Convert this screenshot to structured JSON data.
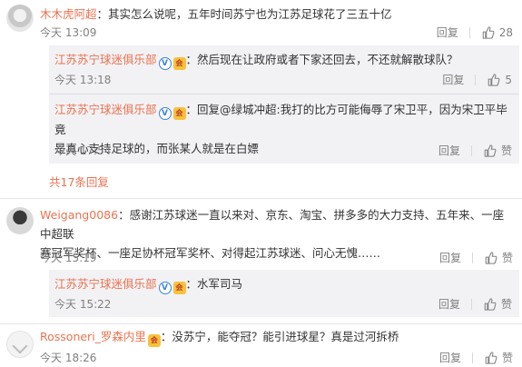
{
  "comments": [
    {
      "username": "木木虎阿超",
      "text": "：其实怎么说呢，五年时间苏宁也为江苏足球花了三五十亿",
      "time": "今天 13:09",
      "reply_label": "回复",
      "likes": "28",
      "replies": [
        {
          "username": "江苏苏宁球迷俱乐部",
          "text": "：然后现在让政府或者下家还回去，不还就解散球队？",
          "time": "今天 13:18",
          "reply_label": "回复",
          "likes": "5"
        },
        {
          "username": "江苏苏宁球迷俱乐部",
          "text_line1": "：回复@绿城冲超:我打的比方可能侮辱了宋卫平，因为宋卫平毕竟",
          "text_line2": "是真心支持足球的，而张某人就是在白嫖",
          "time": "今天 17:54",
          "reply_label": "回复",
          "likes": "赞"
        }
      ],
      "more_replies": "共17条回复"
    },
    {
      "username": "Weigang0086",
      "text_line1": "：感谢江苏球迷一直以来对、京东、淘宝、拼多多的大力支持、五年来、一座中超联",
      "text_line2": "赛冠军奖杯、一座足协杯冠军奖杯、对得起江苏球迷、问心无愧……",
      "time": "今天 15:19",
      "reply_label": "回复",
      "likes": "赞",
      "replies": [
        {
          "username": "江苏苏宁球迷俱乐部",
          "text": "：水军司马",
          "time": "今天 15:22",
          "reply_label": "回复",
          "likes": "赞"
        }
      ]
    },
    {
      "username": "Rossoneri_罗森内里",
      "text": "：没苏宁，能夺冠？能引进球星？真是过河拆桥",
      "time": "今天 18:26",
      "reply_label": "回复",
      "likes": "赞"
    }
  ],
  "badges": {
    "verified": "V",
    "vip": "会"
  },
  "icons": {
    "like": "thumb-up-icon"
  },
  "colors": {
    "username": "#eb7350",
    "meta": "#808080",
    "reply_bg": "#f2f2f5"
  }
}
